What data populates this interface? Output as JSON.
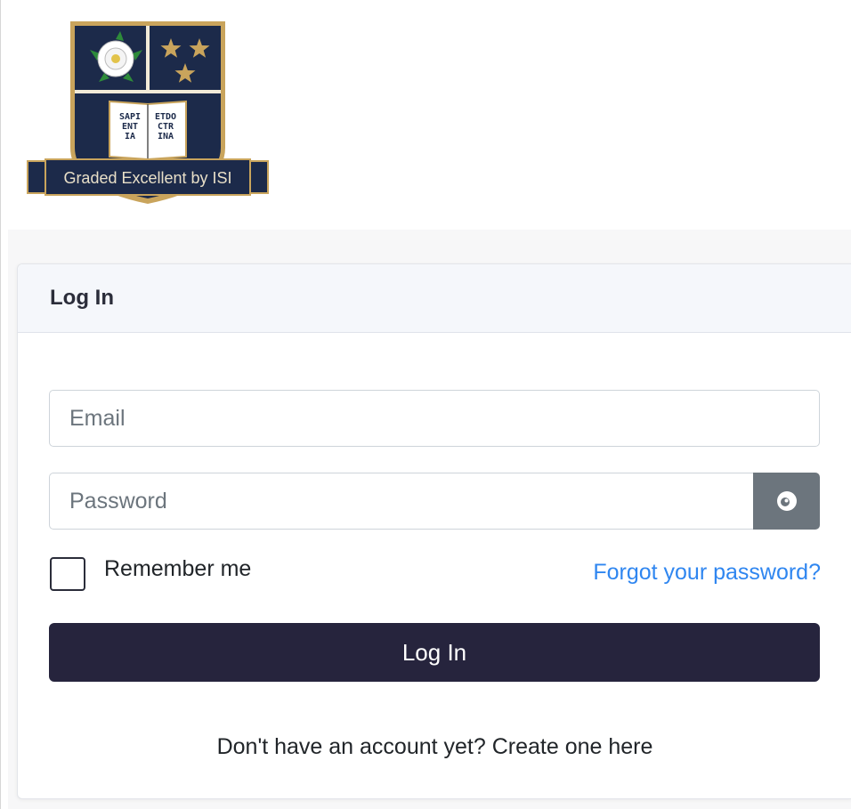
{
  "logo": {
    "banner_text": "Graded Excellent by ISI",
    "book_left": [
      "SAPI",
      "ENT",
      "IA"
    ],
    "book_right": [
      "ETDO",
      "CTR",
      "INA"
    ]
  },
  "card": {
    "title": "Log In"
  },
  "form": {
    "email_placeholder": "Email",
    "password_placeholder": "Password",
    "remember_label": "Remember me",
    "forgot_label": "Forgot your password?",
    "submit_label": "Log In"
  },
  "signup": {
    "prompt": "Don't have an account yet?",
    "link_label": "Create one here"
  },
  "colors": {
    "primary": "#26243d",
    "link": "#2f86f0",
    "eye_button": "#6c757d",
    "crest_navy": "#1c2a4a",
    "crest_gold": "#c9a45c"
  },
  "icons": {
    "logo": "school-crest-icon",
    "rose": "rose-icon",
    "stars": "star-icon",
    "book": "open-book-icon",
    "password_toggle": "eye-icon"
  }
}
